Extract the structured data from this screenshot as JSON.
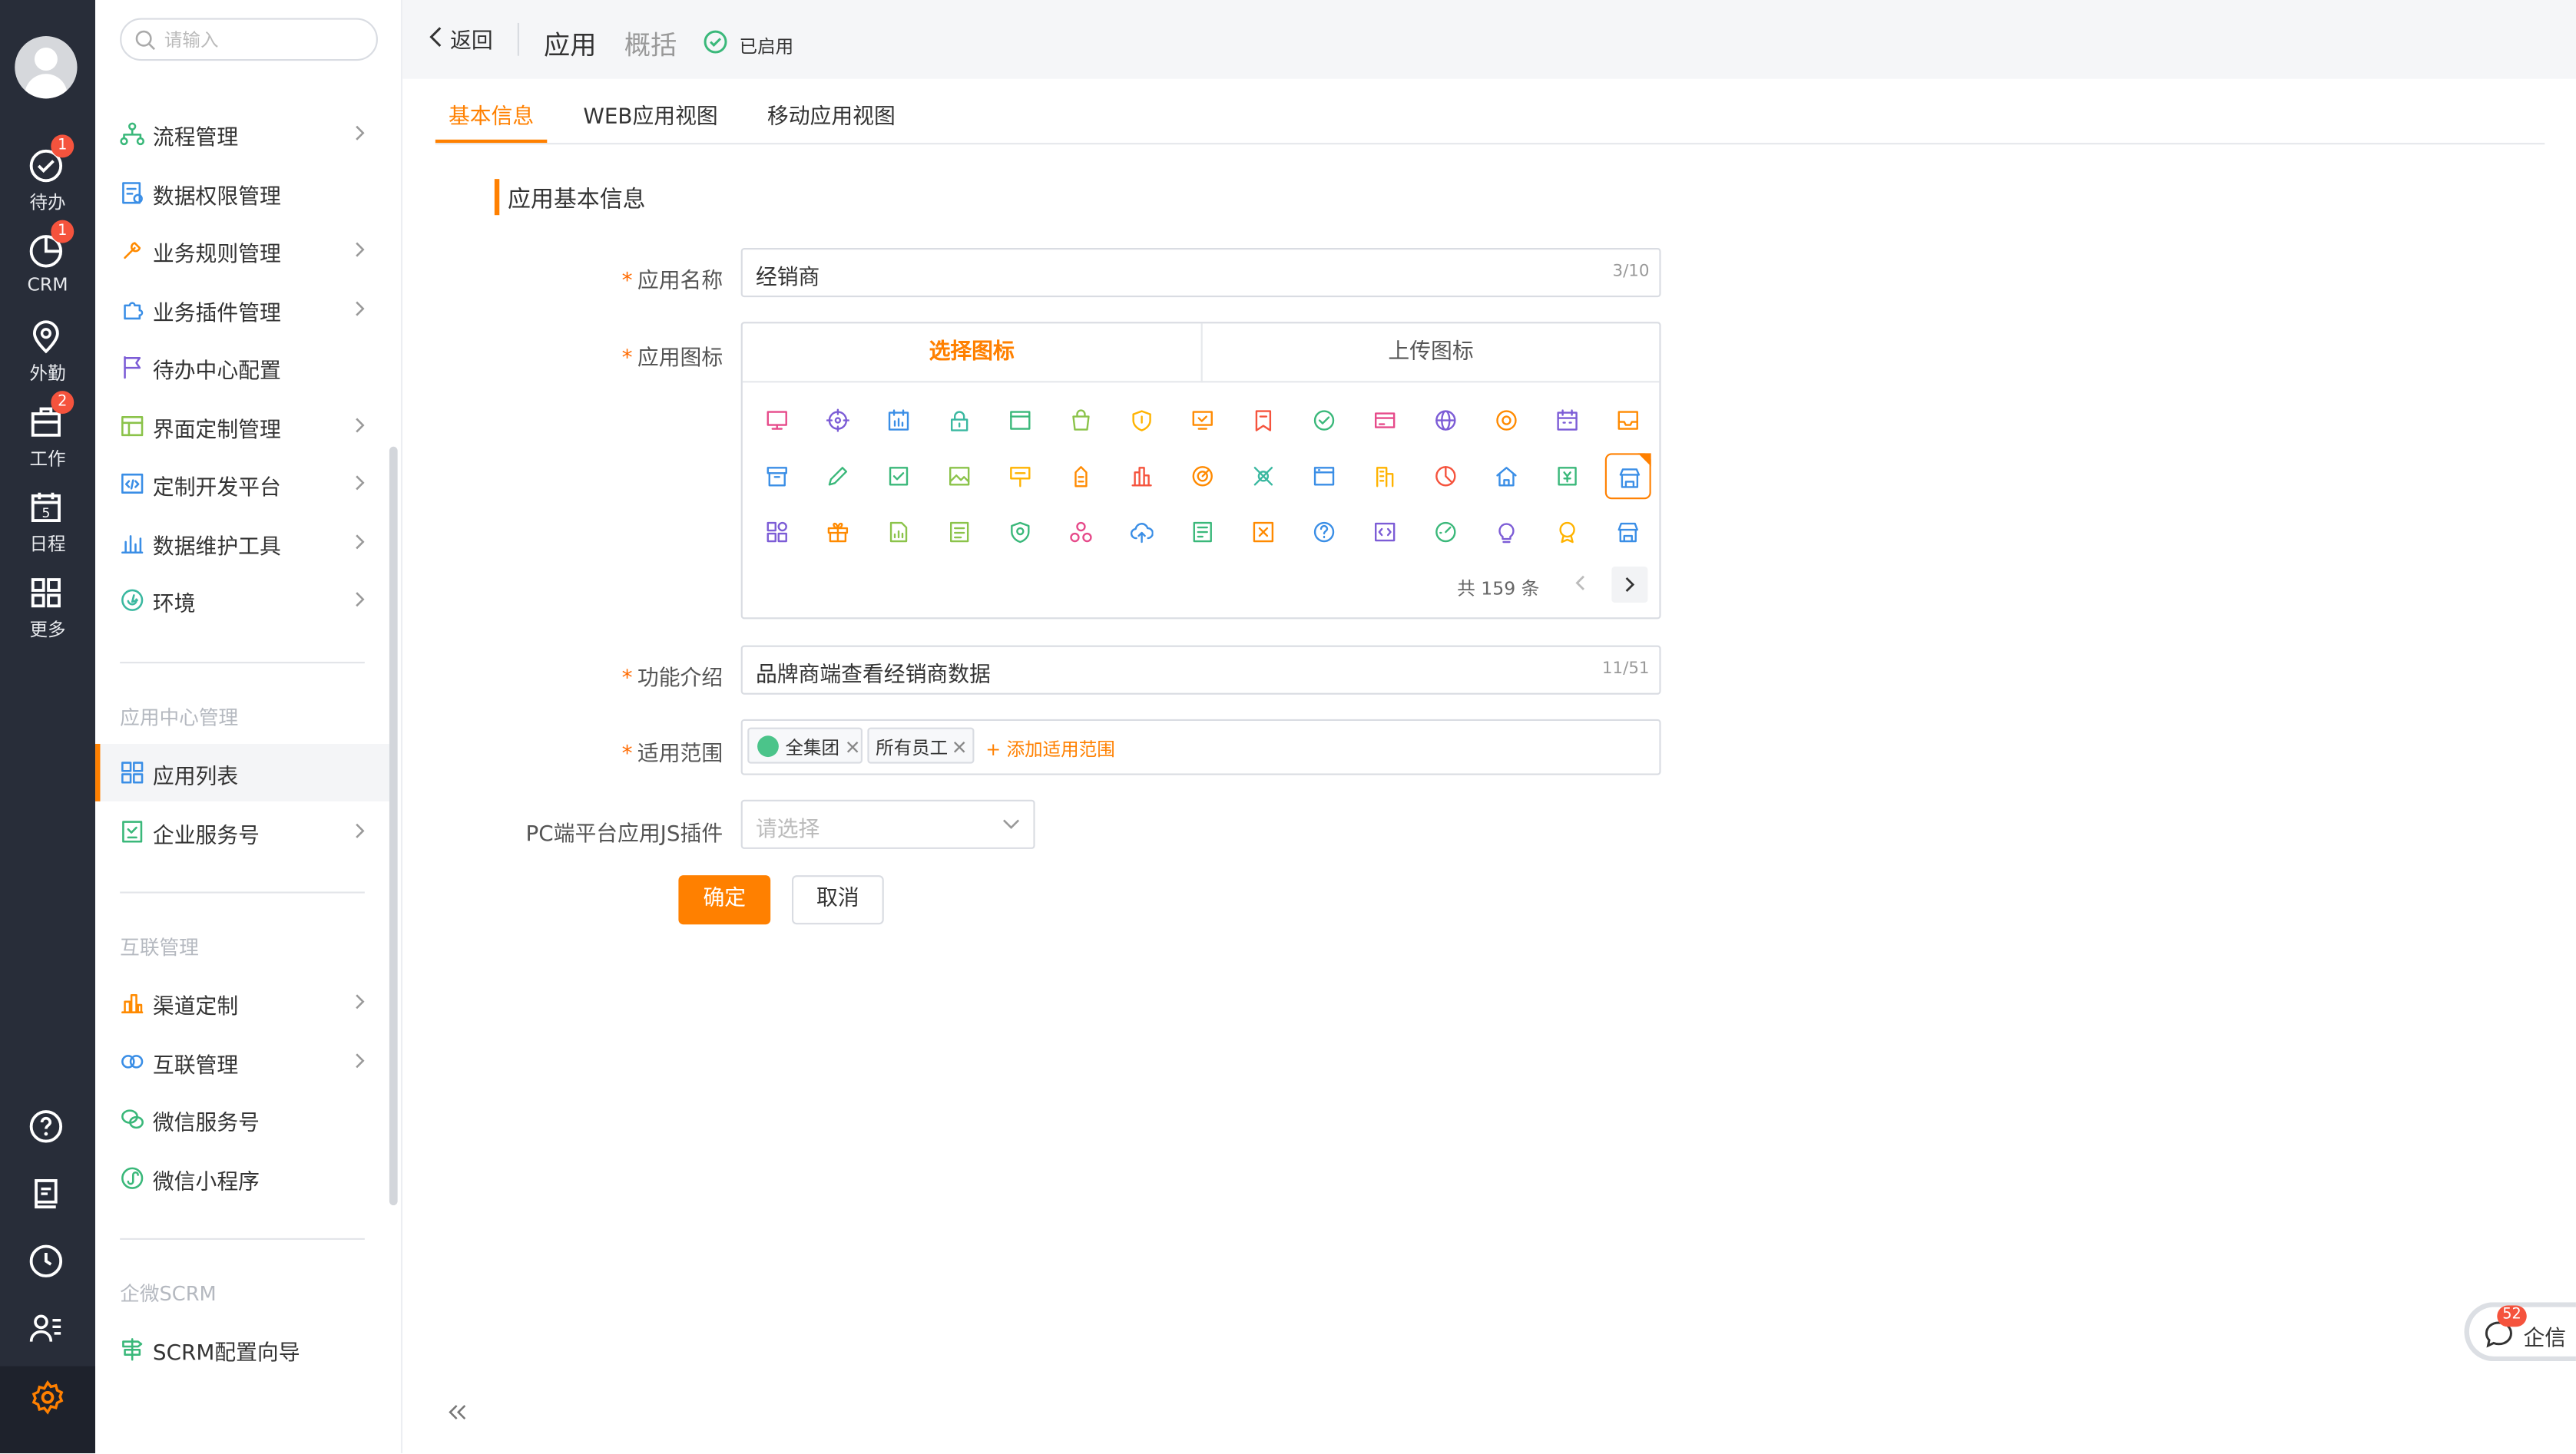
{
  "rail": {
    "items": [
      {
        "label": "待办",
        "badge": "1"
      },
      {
        "label": "CRM",
        "badge": "1"
      },
      {
        "label": "外勤",
        "badge": ""
      },
      {
        "label": "工作",
        "badge": "2"
      },
      {
        "label": "日程",
        "badge": "",
        "icon_digit": "5"
      },
      {
        "label": "更多",
        "badge": ""
      }
    ]
  },
  "sidebar": {
    "search_placeholder": "请输入",
    "items": [
      {
        "label": "流程管理",
        "icon": "flow-icon",
        "color": "#3ab87a"
      },
      {
        "label": "数据权限管理",
        "icon": "data-permission-icon",
        "color": "#3a8ee6"
      },
      {
        "label": "业务规则管理",
        "icon": "rule-icon",
        "color": "#ff8a00"
      },
      {
        "label": "业务插件管理",
        "icon": "plugin-icon",
        "color": "#3a8ee6"
      },
      {
        "label": "待办中心配置",
        "icon": "flag-icon",
        "color": "#7c5cd6"
      },
      {
        "label": "界面定制管理",
        "icon": "layout-icon",
        "color": "#8bc34a"
      },
      {
        "label": "定制开发平台",
        "icon": "code-icon",
        "color": "#3a8ee6"
      },
      {
        "label": "数据维护工具",
        "icon": "bar-icon",
        "color": "#3a8ee6"
      },
      {
        "label": "环境",
        "icon": "env-icon",
        "color": "#3ab8a0"
      }
    ],
    "group_app": "应用中心管理",
    "app_items": [
      {
        "label": "应用列表",
        "icon": "grid-icon",
        "color": "#3a8ee6"
      },
      {
        "label": "企业服务号",
        "icon": "service-icon",
        "color": "#3ab87a"
      }
    ],
    "group_link": "互联管理",
    "link_items": [
      {
        "label": "渠道定制",
        "icon": "channel-icon",
        "color": "#ff8a00"
      },
      {
        "label": "互联管理",
        "icon": "link-icon",
        "color": "#3a8ee6"
      },
      {
        "label": "微信服务号",
        "icon": "wechat-icon",
        "color": "#3ab87a"
      },
      {
        "label": "微信小程序",
        "icon": "miniapp-icon",
        "color": "#3ab87a"
      }
    ],
    "group_scrm": "企微SCRM",
    "scrm_items": [
      {
        "label": "SCRM配置向导",
        "icon": "signpost-icon",
        "color": "#3ab87a"
      }
    ]
  },
  "header": {
    "back": "返回",
    "title": "应用",
    "subtitle": "概括",
    "status": "已启用"
  },
  "tabs": [
    "基本信息",
    "WEB应用视图",
    "移动应用视图"
  ],
  "form": {
    "section_title": "应用基本信息",
    "name_label": "应用名称",
    "name_value": "经销商",
    "name_count": "3/10",
    "icon_label": "应用图标",
    "icon_tab_select": "选择图标",
    "icon_tab_upload": "上传图标",
    "icon_total": "共 159 条",
    "desc_label": "功能介绍",
    "desc_value": "品牌商端查看经销商数据",
    "desc_count": "11/51",
    "scope_label": "适用范围",
    "scope_tags": [
      "全集团",
      "所有员工"
    ],
    "scope_add": "+ 添加适用范围",
    "js_label": "PC端平台应用JS插件",
    "js_placeholder": "请选择",
    "ok": "确定",
    "cancel": "取消"
  },
  "icon_grid": [
    {
      "icon": "monitor-icon",
      "color": "#e64a8a"
    },
    {
      "icon": "target-icon",
      "color": "#7c5cd6"
    },
    {
      "icon": "calendar-chart-icon",
      "color": "#3a8ee6"
    },
    {
      "icon": "lock-icon",
      "color": "#3ab8a0"
    },
    {
      "icon": "window-icon",
      "color": "#3ab87a"
    },
    {
      "icon": "bag-icon",
      "color": "#8bc34a"
    },
    {
      "icon": "shield-icon",
      "color": "#ffb300"
    },
    {
      "icon": "screen-check-icon",
      "color": "#ff8a00"
    },
    {
      "icon": "bookmark-icon",
      "color": "#f5533d"
    },
    {
      "icon": "check-circle-icon",
      "color": "#3ab87a"
    },
    {
      "icon": "card-icon",
      "color": "#e64a8a"
    },
    {
      "icon": "globe-icon",
      "color": "#7c5cd6"
    },
    {
      "icon": "coin-icon",
      "color": "#ff8a00"
    },
    {
      "icon": "calendar-icon",
      "color": "#7c5cd6"
    },
    {
      "icon": "inbox-icon",
      "color": "#ff8a00"
    },
    {
      "icon": "archive-icon",
      "color": "#3a8ee6"
    },
    {
      "icon": "pencil-icon",
      "color": "#3ab87a"
    },
    {
      "icon": "checkbox-icon",
      "color": "#3ab87a"
    },
    {
      "icon": "image-icon",
      "color": "#8bc34a"
    },
    {
      "icon": "sign-icon",
      "color": "#ffb300"
    },
    {
      "icon": "tower-icon",
      "color": "#ff8a00"
    },
    {
      "icon": "building-icon",
      "color": "#f5533d"
    },
    {
      "icon": "radar-icon",
      "color": "#ff8a00"
    },
    {
      "icon": "puzzle-icon",
      "color": "#3ab8a0"
    },
    {
      "icon": "browser-icon",
      "color": "#3a8ee6"
    },
    {
      "icon": "office-icon",
      "color": "#ffb300"
    },
    {
      "icon": "pie-icon",
      "color": "#f5533d"
    },
    {
      "icon": "home-icon",
      "color": "#3a8ee6"
    },
    {
      "icon": "price-icon",
      "color": "#3ab87a"
    },
    {
      "icon": "store-icon",
      "color": "#3a8ee6"
    },
    {
      "icon": "apps-icon",
      "color": "#7c5cd6"
    },
    {
      "icon": "gift-icon",
      "color": "#ff8a00"
    },
    {
      "icon": "doc-chart-icon",
      "color": "#8bc34a"
    },
    {
      "icon": "list-icon",
      "color": "#8bc34a"
    },
    {
      "icon": "badge-icon",
      "color": "#3ab87a"
    },
    {
      "icon": "network-icon",
      "color": "#e64a8a"
    },
    {
      "icon": "cloud-upload-icon",
      "color": "#3a8ee6"
    },
    {
      "icon": "form-icon",
      "color": "#3ab87a"
    },
    {
      "icon": "box-icon",
      "color": "#ff8a00"
    },
    {
      "icon": "question-icon",
      "color": "#3a8ee6"
    },
    {
      "icon": "code-box-icon",
      "color": "#7c5cd6"
    },
    {
      "icon": "speed-icon",
      "color": "#3ab87a"
    },
    {
      "icon": "bulb-icon",
      "color": "#7c5cd6"
    },
    {
      "icon": "award-icon",
      "color": "#ffb300"
    },
    {
      "icon": "shop-icon",
      "color": "#3a8ee6"
    }
  ],
  "icon_selected": 29,
  "chat": {
    "label": "企信",
    "badge": "52"
  },
  "colors": {
    "accent": "#ff8000",
    "rail": "#282d39",
    "badge": "#f5533d"
  }
}
